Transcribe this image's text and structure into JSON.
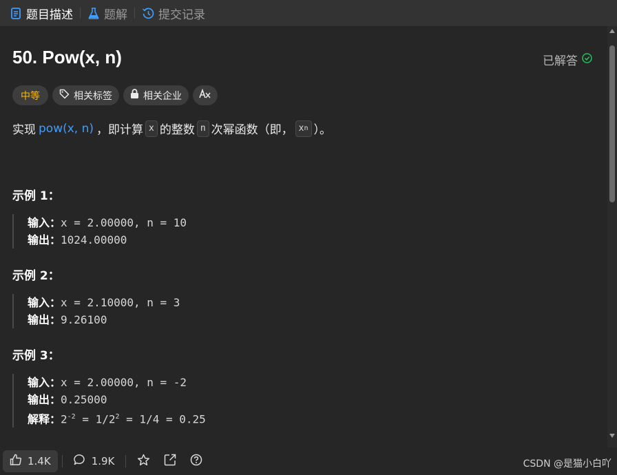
{
  "tabs": [
    {
      "label": "题目描述",
      "icon": "document-icon",
      "active": true
    },
    {
      "label": "题解",
      "icon": "flask-icon",
      "active": false
    },
    {
      "label": "提交记录",
      "icon": "history-icon",
      "active": false
    }
  ],
  "problem": {
    "title": "50. Pow(x, n)",
    "status": "已解答",
    "tags": {
      "difficulty": "中等",
      "related_tags": "相关标签",
      "related_companies": "相关企业"
    },
    "description": {
      "prefix": "实现",
      "link": "pow(x, n)",
      "mid1": "，即计算",
      "code_x": "x",
      "mid2": "的整数",
      "code_n": "n",
      "mid3": "次幂函数（即，",
      "code_xn_base": "x",
      "code_xn_exp": "n",
      "suffix": "）。"
    },
    "examples": [
      {
        "title": "示例 1：",
        "input_label": "输入：",
        "input": "x = 2.00000, n = 10",
        "output_label": "输出：",
        "output": "1024.00000"
      },
      {
        "title": "示例 2：",
        "input_label": "输入：",
        "input": "x = 2.10000, n = 3",
        "output_label": "输出：",
        "output": "9.26100"
      },
      {
        "title": "示例 3：",
        "input_label": "输入：",
        "input": "x = 2.00000, n = -2",
        "output_label": "输出：",
        "output": "0.25000",
        "explain_label": "解释：",
        "explain_base": "2",
        "explain_exp": "-2",
        "explain_mid": " = 1/2",
        "explain_exp2": "2",
        "explain_tail": " = 1/4 = 0.25"
      }
    ]
  },
  "bottom": {
    "likes": "1.4K",
    "comments": "1.9K"
  },
  "watermark": "CSDN @是猫小白吖",
  "colors": {
    "accent_link": "#3e9dff",
    "difficulty": "#ffb800",
    "solved_check": "#2cbb5d",
    "tab_active_icon": "#3e9dff"
  }
}
